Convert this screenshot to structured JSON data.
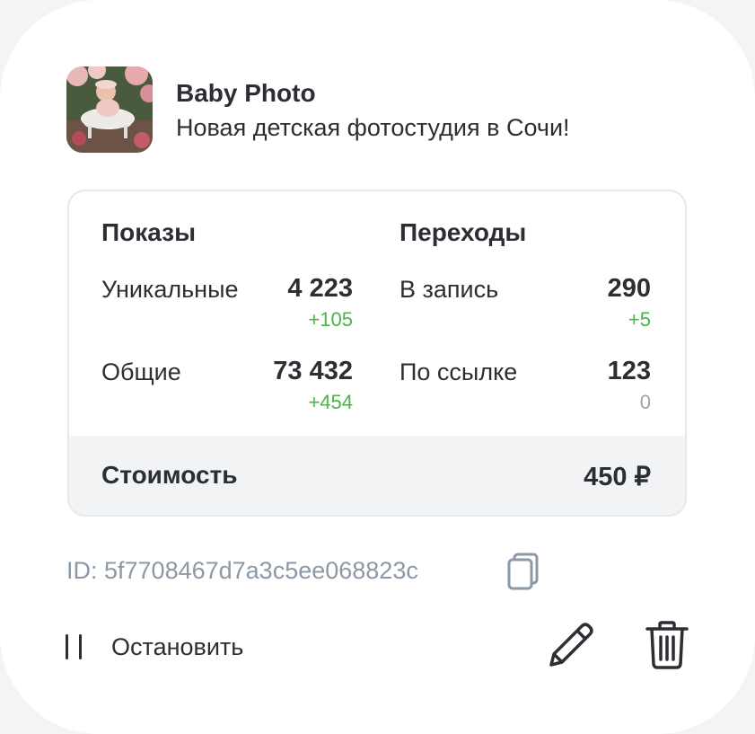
{
  "ad": {
    "title": "Baby Photo",
    "subtitle": "Новая детская фотостудия в Сочи!"
  },
  "stats": {
    "impressions": {
      "heading": "Показы",
      "unique_label": "Уникальные",
      "unique_value": "4 223",
      "unique_delta": "+105",
      "total_label": "Общие",
      "total_value": "73 432",
      "total_delta": "+454"
    },
    "clicks": {
      "heading": "Переходы",
      "post_label": "В запись",
      "post_value": "290",
      "post_delta": "+5",
      "link_label": "По ссылке",
      "link_value": "123",
      "link_delta": "0"
    },
    "cost_label": "Стоимость",
    "cost_value": "450 ₽"
  },
  "id_text": "ID: 5f7708467d7a3c5ee068823c",
  "actions": {
    "stop_label": "Остановить"
  },
  "colors": {
    "positive": "#4bb34b",
    "neutral": "#99a2ad",
    "text": "#2b2f33",
    "muted": "#8b98a6"
  },
  "icons": [
    "copy-icon",
    "pause-icon",
    "pencil-icon",
    "trash-icon"
  ]
}
